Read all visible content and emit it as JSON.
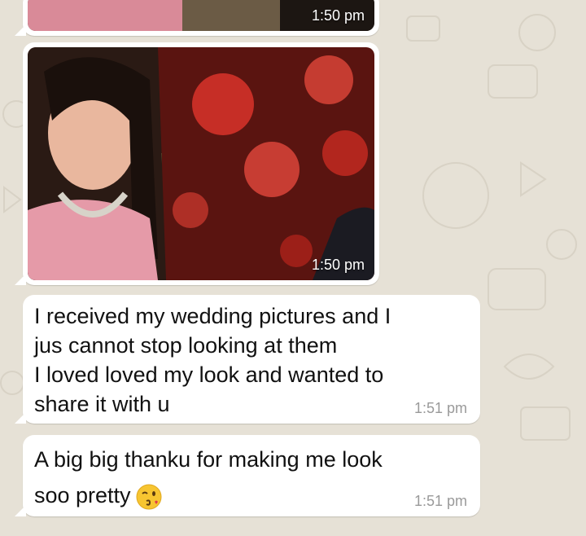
{
  "messages": [
    {
      "type": "image",
      "time": "1:50 pm"
    },
    {
      "type": "image",
      "time": "1:50 pm"
    },
    {
      "type": "text",
      "lines": [
        "I received my wedding pictures and I",
        "jus cannot stop looking at them",
        "I loved loved my look and wanted to",
        "share it with u"
      ],
      "time": "1:51 pm"
    },
    {
      "type": "text",
      "lines": [
        "A big big thanku for making me look",
        "soo pretty"
      ],
      "emoji": "kissing-wink-emoji",
      "time": "1:51 pm"
    }
  ],
  "colors": {
    "chat_background": "#e6e1d6",
    "bubble": "#ffffff",
    "timestamp": "#9a9a9a"
  }
}
